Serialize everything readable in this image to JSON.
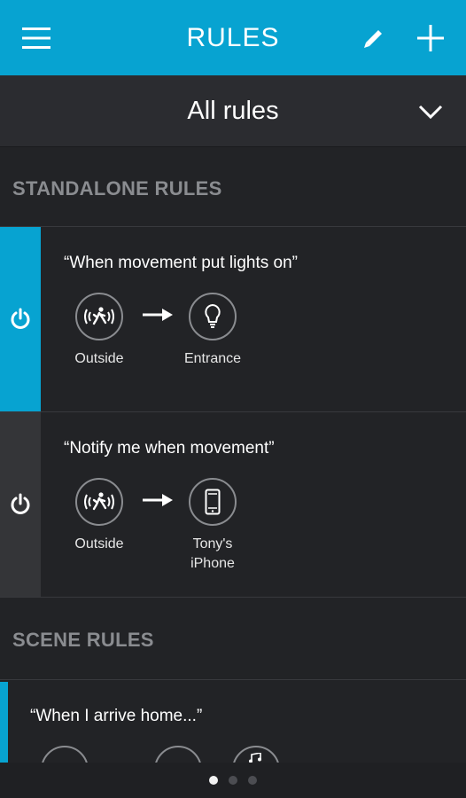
{
  "header": {
    "title": "RULES"
  },
  "filter": {
    "selected": "All rules"
  },
  "sections": {
    "standalone": "STANDALONE RULES",
    "scene": "SCENE RULES"
  },
  "rules": [
    {
      "title": "“When movement put lights on”",
      "active": true,
      "trigger": {
        "icon": "motion-sensor-icon",
        "label": "Outside"
      },
      "action": {
        "icon": "lightbulb-icon",
        "label": "Entrance"
      }
    },
    {
      "title": "“Notify me when movement”",
      "active": false,
      "trigger": {
        "icon": "motion-sensor-icon",
        "label": "Outside"
      },
      "action": {
        "icon": "phone-icon",
        "label_line1": "Tony's",
        "label_line2": "iPhone"
      }
    }
  ],
  "scene_rules": [
    {
      "title": "“When I arrive home...”"
    }
  ],
  "pager": {
    "pages": 3,
    "current": 0
  },
  "colors": {
    "accent": "#07a3d1",
    "background": "#222326",
    "inactive_strip": "#343538"
  }
}
